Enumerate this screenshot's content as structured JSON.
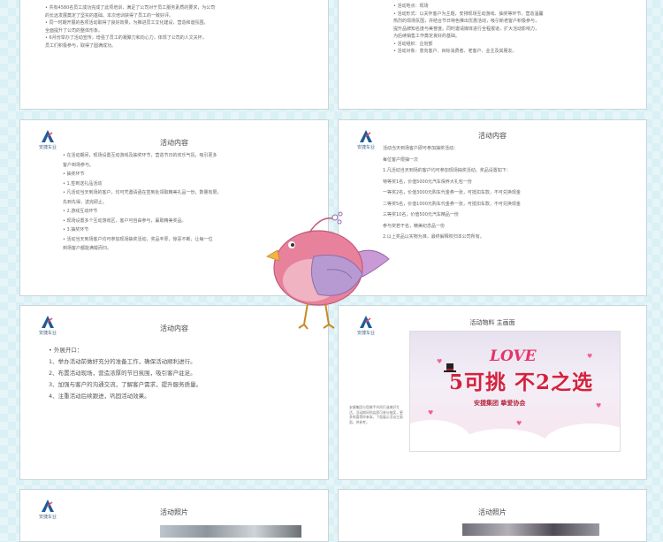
{
  "slides": {
    "s1": {
      "lines": [
        "• 共有4580名员工成功完成了此项培训，满足了公司对于员工服务素质的要求，为公司",
        "  的长远发展奠定了坚实的基础。本次培训获得了员工的一致好评。",
        "• 同一时期开展的各项活动取得了良好效果，为推进员工文化建设，营造和谐氛围，",
        "  全面提升了公司的整体形象。",
        "• 6月份举办了活动宣传，增强了员工的凝聚力和向心力，体现了公司的人文关怀，",
        "  员工们积极参与，取得了圆满成功。"
      ]
    },
    "s2": {
      "lines": [
        "• 活动地点：现场",
        "• 活动形式：以关怀客户为主题，安排现场互动游戏、抽奖等环节，营造温馨",
        "  热烈的现场氛围，并结合节日特色推出优惠活动，吸引新老客户积极参与，",
        "  提升品牌知名度与美誉度。同时邀请媒体进行全程报道，扩大活动影响力，",
        "  为后续销售工作奠定良好的基础。",
        "• 活动组织：企划部",
        "• 活动对象：意向客户、目标消费者、老客户、业主及其朋友。"
      ]
    },
    "s3": {
      "logo_caption": "安捷车业",
      "title": "活动内容",
      "lines": [
        "• 在活动期间，现场设置互动游戏及抽奖环节，营造节日的欢乐气氛，吸引更多",
        "  客户到场参与。",
        "• 抽奖环节",
        "• 1.签到送礼品活动",
        "• 凡活动当天到场的客户，均可凭邀请函在签到处领取精美礼品一份，数量有限，",
        "  先到先得，送完即止。",
        "• 2.游戏互动环节",
        "• 现场设置多个互动游戏区，客户可自由参与，赢取精美奖品。",
        "• 3.抽奖环节",
        "• 活动当天到场客户均可参加现场抽奖活动，奖品丰厚，惊喜不断，让每一位",
        "  到场客户都能满载而归。"
      ]
    },
    "s4": {
      "logo_caption": "安捷车业",
      "title": "活动内容",
      "lines": [
        "活动当天到场客户即可参加抽奖活动：",
        "每位客户限抽一次",
        "1.凡活动当天到场的客户均可参加现场抽奖活动，奖品设置如下：",
        "  特等奖1名，价值5000元汽车保养大礼包一份",
        "  一等奖2名，价值3000元购车代金券一张，可抵扣车款，不可兑换现金",
        "  二等奖5名，价值1000元购车代金券一张，可抵扣车款，不可兑换现金",
        "  三等奖10名，价值500元汽车精品一份",
        "  参与奖若干名，精美纪念品一份",
        "2.以上奖品以实物为准，最终解释权归本公司所有。"
      ]
    },
    "s5": {
      "logo_caption": "安捷车业",
      "title": "活动内容",
      "lines": [
        "• 外展开口：",
        "1、举办活动前做好充分的准备工作，确保活动顺利进行。",
        "2、布置活动现场，营造浓厚的节日氛围，吸引客户驻足。",
        "3、加强与客户的沟通交流，了解客户需求，提升服务质量。",
        "4、注重活动后续跟进，巩固活动效果。"
      ]
    },
    "s6": {
      "logo_caption": "安捷车业",
      "title": "活动物料 主画面",
      "poster_love": "LOVE",
      "poster_main": "5可挑 不2之选",
      "poster_sub": "安捷集团 挚爱协会",
      "note": "安捷集团与您携手共同打造美好生活，活动期间到店即可参与抽奖，更多惊喜等你来拿。下面展示活动主画面，供参考。"
    },
    "s7": {
      "logo_caption": "安捷车业",
      "title": "活动照片"
    },
    "s8": {
      "title": "活动照片"
    }
  },
  "colors": {
    "bg": "#d9f0f5",
    "accent": "#d5213c",
    "logo": "#1f5c99"
  },
  "icons": {
    "logo": "company-logo-icon",
    "mascot": "pink-bird-mascot"
  }
}
